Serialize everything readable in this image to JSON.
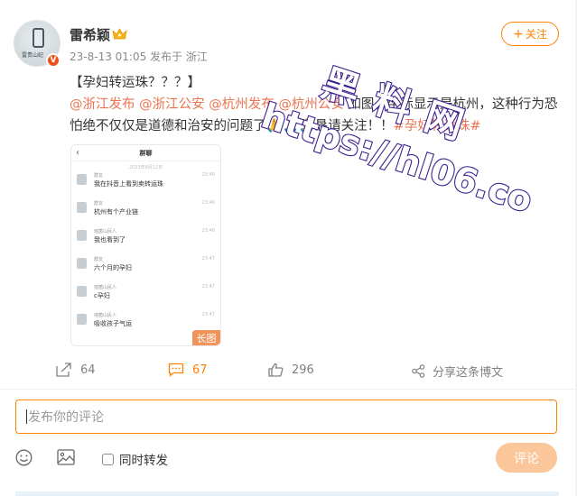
{
  "post": {
    "author": "雷希颖",
    "avatar_text": "雷贵山纪",
    "verified_badge": "V",
    "meta": "23-8-13 01:05 发布于 浙江",
    "follow_label": "关注",
    "content_line1": "【孕妇转运珠？？？】",
    "mentions": [
      "@浙江发布",
      "@浙江公安",
      "@杭州发布",
      "@杭州公安"
    ],
    "content_rest": " 如图，坐标显示是杭州，这种行为恐怕绝不仅仅是道德和治安的问题了🙏🙏🙏恳请关注！！",
    "hashtag": "#孕妇转运珠#",
    "long_image_tag": "长图"
  },
  "chat_image": {
    "title": "群聊",
    "date": "2023年8月12日",
    "messages": [
      {
        "name": "群友",
        "time": "23:46",
        "text": "我在抖音上看到卖转运珠"
      },
      {
        "name": "群友",
        "time": "23:46",
        "text": "杭州有个产业链"
      },
      {
        "name": "瑶菌山民人",
        "time": "23:46",
        "text": "我也看到了"
      },
      {
        "name": "群友",
        "time": "23:47",
        "text": "六个月的孕妇"
      },
      {
        "name": "瑶菌山民人",
        "time": "23:47",
        "text": "c孕妇"
      },
      {
        "name": "瑶菌山民人",
        "time": "23:47",
        "text": "吸收孩子气运"
      }
    ]
  },
  "actions": {
    "repost_count": "64",
    "comment_count": "67",
    "like_count": "296",
    "share_label": "分享这条博文"
  },
  "composer": {
    "placeholder": "发布你的评论",
    "repost_checkbox_label": "同时转发",
    "submit_label": "评论"
  },
  "watermark": {
    "line1": "黑料网",
    "line2": "https://hl06.co"
  },
  "colors": {
    "accent": "#ff8200",
    "link": "#eb7350",
    "submit_disabled": "#fbc69a",
    "watermark": "#3a1f8f"
  }
}
